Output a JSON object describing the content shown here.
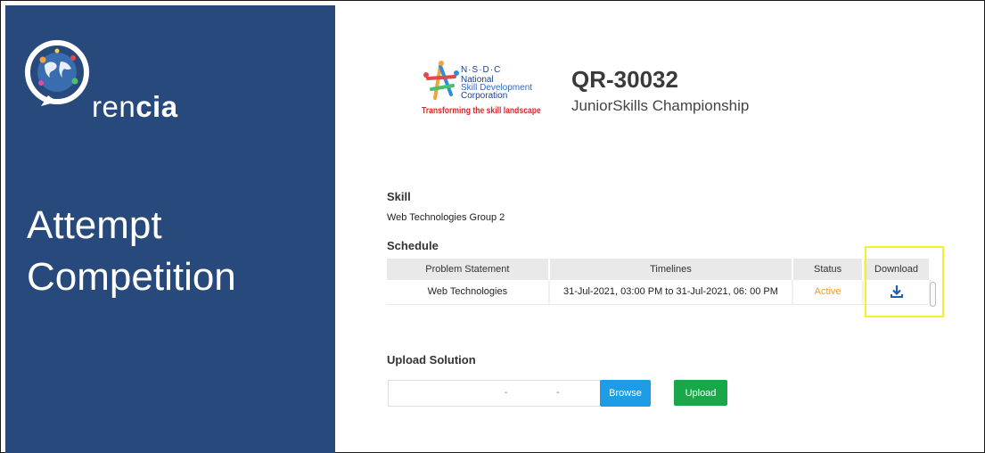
{
  "sidebar": {
    "logo_prefix": "ren",
    "logo_suffix": "cia",
    "title_line1": "Attempt",
    "title_line2": "Competition"
  },
  "org": {
    "abbr": "N·S·D·C",
    "name_line1": "National",
    "name_line2": "Skill Development",
    "name_line3": "Corporation",
    "tagline": "Transforming the skill landscape"
  },
  "competition": {
    "id": "QR-30032",
    "name": "JuniorSkills Championship"
  },
  "skill": {
    "label": "Skill",
    "value": "Web Technologies Group 2"
  },
  "schedule": {
    "label": "Schedule",
    "headers": [
      "Problem Statement",
      "Timelines",
      "Status",
      "Download"
    ],
    "rows": [
      {
        "problem": "Web Technologies",
        "timeline": "31-Jul-2021, 03:00 PM to 31-Jul-2021, 06: 00 PM",
        "status": "Active"
      }
    ]
  },
  "upload": {
    "label": "Upload Solution",
    "input_value": "- -",
    "browse_label": "Browse",
    "upload_label": "Upload"
  },
  "colors": {
    "sidebar_bg": "#27497c",
    "status_active": "#f0a020",
    "browse": "#1e9ce6",
    "upload": "#18a84a",
    "highlight": "#f6f02a",
    "download_icon": "#1f5fb0"
  }
}
